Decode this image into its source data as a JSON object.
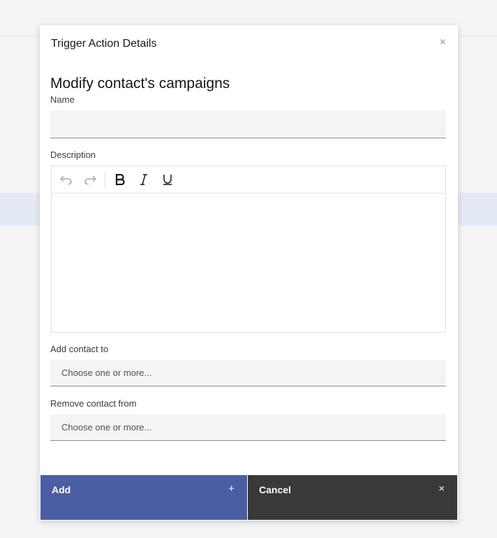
{
  "modal": {
    "title": "Trigger Action Details",
    "close_glyph": "×",
    "heading": "Modify contact's campaigns"
  },
  "form": {
    "name_label": "Name",
    "name_value": "",
    "description_label": "Description",
    "add_to_label": "Add contact to",
    "add_to_placeholder": "Choose one or more...",
    "remove_from_label": "Remove contact from",
    "remove_from_placeholder": "Choose one or more..."
  },
  "toolbar": {
    "icons": [
      "undo-icon",
      "redo-icon",
      "bold-icon",
      "italic-icon",
      "underline-icon"
    ]
  },
  "footer": {
    "add_label": "Add",
    "add_glyph": "+",
    "cancel_label": "Cancel",
    "cancel_glyph": "×"
  },
  "colors": {
    "primary": "#4b5ea3",
    "secondary": "#393939",
    "field_bg": "#f4f4f4"
  }
}
